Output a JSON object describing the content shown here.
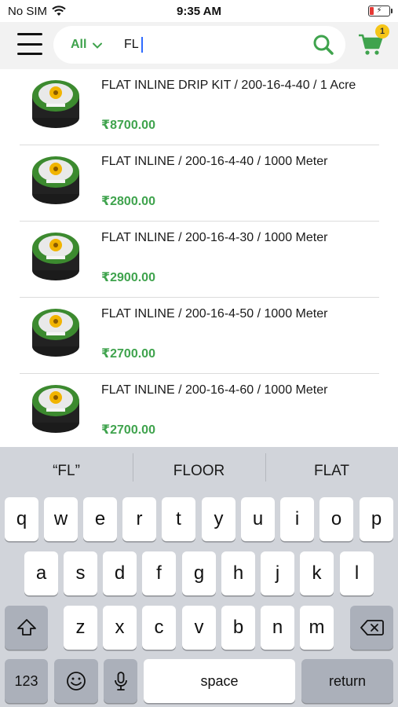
{
  "status_bar": {
    "carrier": "No SIM",
    "time": "9:35 AM",
    "battery_level": 0.2,
    "battery_color": "#e53935"
  },
  "header": {
    "category": "All",
    "search_value": "FL",
    "cart_count": "1",
    "accent_color": "#3fa34d"
  },
  "products": [
    {
      "name": "FLAT INLINE DRIP KIT / 200-16-4-40 / 1 Acre",
      "price": "₹8700.00"
    },
    {
      "name": "FLAT INLINE / 200-16-4-40 / 1000 Meter",
      "price": "₹2800.00"
    },
    {
      "name": "FLAT INLINE / 200-16-4-30 / 1000 Meter",
      "price": "₹2900.00"
    },
    {
      "name": "FLAT INLINE / 200-16-4-50 / 1000 Meter",
      "price": "₹2700.00"
    },
    {
      "name": "FLAT INLINE / 200-16-4-60 / 1000 Meter",
      "price": "₹2700.00"
    }
  ],
  "keyboard": {
    "suggestions": [
      "“FL”",
      "FLOOR",
      "FLAT"
    ],
    "row1": [
      "q",
      "w",
      "e",
      "r",
      "t",
      "y",
      "u",
      "i",
      "o",
      "p"
    ],
    "row2": [
      "a",
      "s",
      "d",
      "f",
      "g",
      "h",
      "j",
      "k",
      "l"
    ],
    "row3": [
      "z",
      "x",
      "c",
      "v",
      "b",
      "n",
      "m"
    ],
    "numbers_key": "123",
    "space_key": "space",
    "return_key": "return"
  }
}
